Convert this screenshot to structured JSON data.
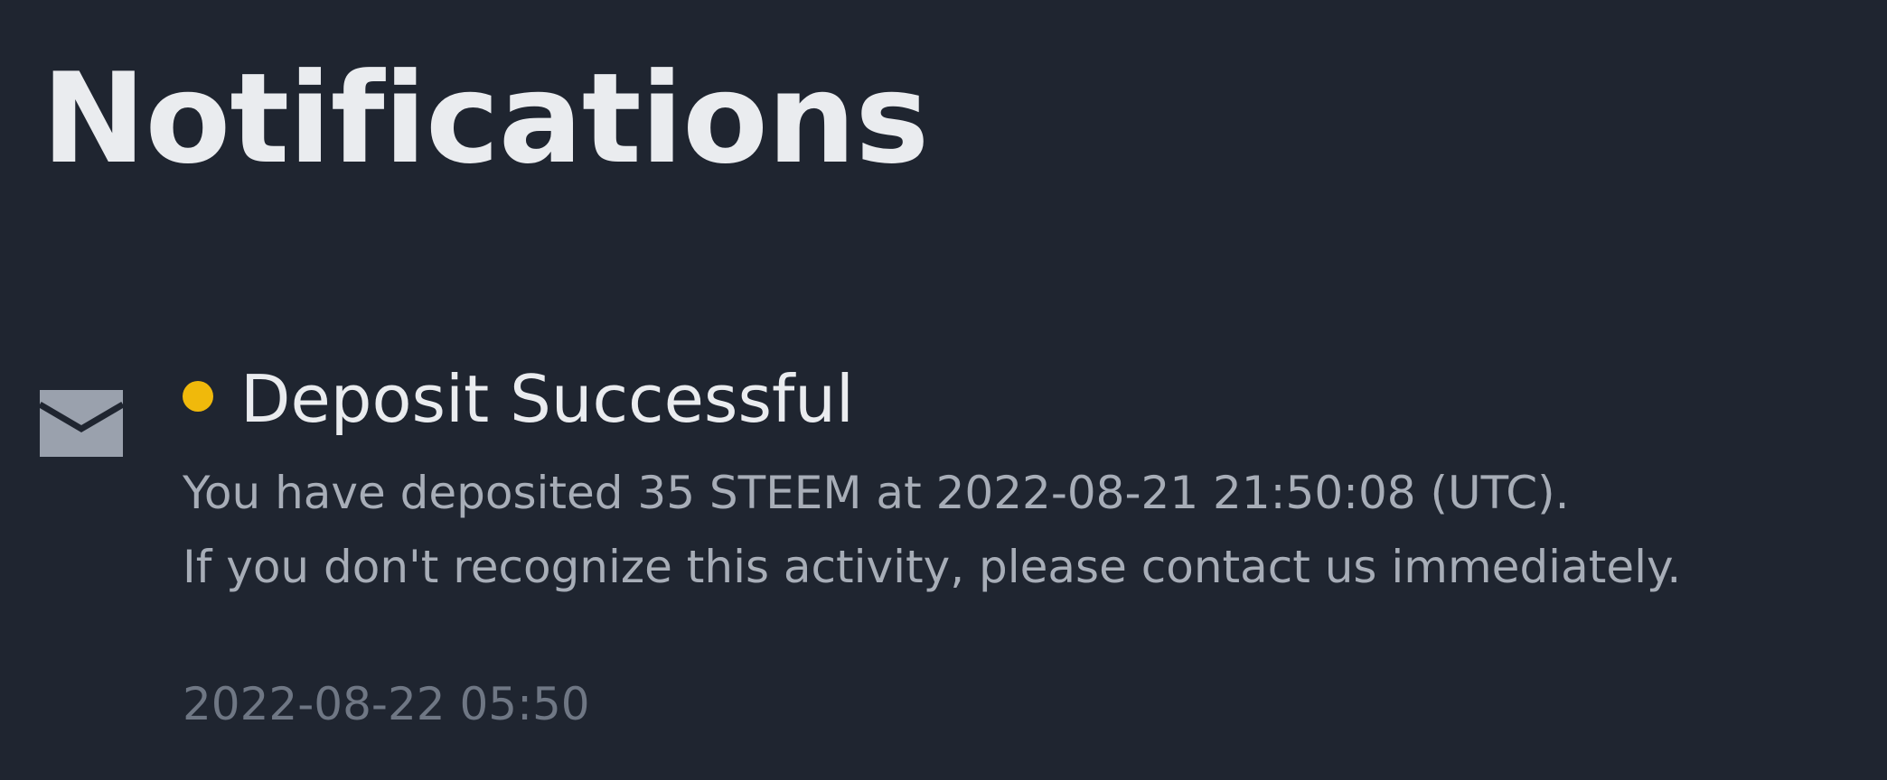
{
  "header": {
    "title": "Notifications"
  },
  "notifications": [
    {
      "icon": "mail-icon",
      "unread": true,
      "unread_color": "#f0b90b",
      "title": "Deposit Successful",
      "body_line_1": "You have deposited 35 STEEM at 2022-08-21 21:50:08 (UTC).",
      "body_line_2": "If you don't recognize this activity, please contact us immediately.",
      "timestamp": "2022-08-22 05:50"
    }
  ]
}
